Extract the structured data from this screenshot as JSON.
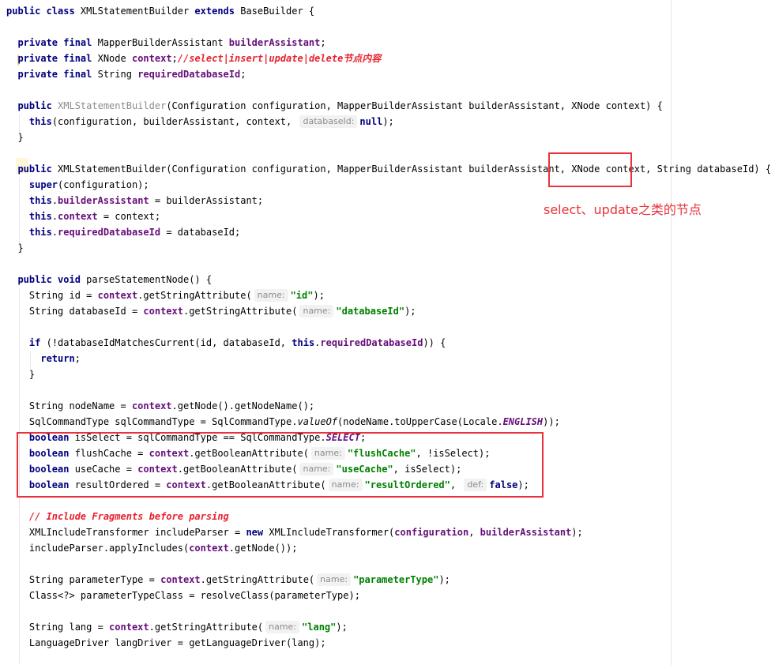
{
  "editor": {
    "language": "java",
    "colors": {
      "keyword": "#000080",
      "field": "#660e7a",
      "string": "#008000",
      "comment": "#e8222e",
      "highlight_box": "#e8333a",
      "hint_bg": "#f2f2f2"
    },
    "lines": [
      {
        "segs": [
          {
            "t": "public class ",
            "c": "kw"
          },
          {
            "t": "XMLStatementBuilder "
          },
          {
            "t": "extends ",
            "c": "kw"
          },
          {
            "t": "BaseBuilder {"
          }
        ]
      },
      {
        "segs": []
      },
      {
        "segs": [
          {
            "t": "  "
          },
          {
            "t": "private final ",
            "c": "kw"
          },
          {
            "t": "MapperBuilderAssistant "
          },
          {
            "t": "builderAssistant",
            "c": "field"
          },
          {
            "t": ";"
          }
        ]
      },
      {
        "segs": [
          {
            "t": "  "
          },
          {
            "t": "private final ",
            "c": "kw"
          },
          {
            "t": "XNode "
          },
          {
            "t": "context",
            "c": "field"
          },
          {
            "t": ";"
          },
          {
            "t": "//select|insert|update|delete节点内容",
            "c": "cmt"
          }
        ]
      },
      {
        "segs": [
          {
            "t": "  "
          },
          {
            "t": "private final ",
            "c": "kw"
          },
          {
            "t": "String "
          },
          {
            "t": "requiredDatabaseId",
            "c": "field"
          },
          {
            "t": ";"
          }
        ]
      },
      {
        "segs": []
      },
      {
        "segs": [
          {
            "t": "  "
          },
          {
            "t": "public ",
            "c": "kw"
          },
          {
            "t": "XMLStatementBuilder",
            "c": "unused"
          },
          {
            "t": "(Configuration configuration, MapperBuilderAssistant builderAssistant, XNode context) {"
          }
        ]
      },
      {
        "segs": [
          {
            "t": "    "
          },
          {
            "t": "this",
            "c": "kw"
          },
          {
            "t": "(configuration, builderAssistant, context, "
          },
          {
            "t": "databaseId:",
            "c": "hint"
          },
          {
            "t": "null",
            "c": "kw"
          },
          {
            "t": ");"
          }
        ]
      },
      {
        "segs": [
          {
            "t": "  }"
          }
        ]
      },
      {
        "segs": []
      },
      {
        "segs": [
          {
            "t": "  "
          },
          {
            "t": "public ",
            "c": "kw"
          },
          {
            "t": "XMLStatementBuilder(Configuration configuration, MapperBuilderAssistant builderAssistant, XNode context, String databaseId) {"
          }
        ]
      },
      {
        "segs": [
          {
            "t": "    "
          },
          {
            "t": "super",
            "c": "kw"
          },
          {
            "t": "(configuration);"
          }
        ]
      },
      {
        "segs": [
          {
            "t": "    "
          },
          {
            "t": "this",
            "c": "kw"
          },
          {
            "t": "."
          },
          {
            "t": "builderAssistant",
            "c": "field"
          },
          {
            "t": " = builderAssistant;"
          }
        ]
      },
      {
        "segs": [
          {
            "t": "    "
          },
          {
            "t": "this",
            "c": "kw"
          },
          {
            "t": "."
          },
          {
            "t": "context",
            "c": "field"
          },
          {
            "t": " = context;"
          }
        ]
      },
      {
        "segs": [
          {
            "t": "    "
          },
          {
            "t": "this",
            "c": "kw"
          },
          {
            "t": "."
          },
          {
            "t": "requiredDatabaseId",
            "c": "field"
          },
          {
            "t": " = databaseId;"
          }
        ]
      },
      {
        "segs": [
          {
            "t": "  }"
          }
        ]
      },
      {
        "segs": []
      },
      {
        "segs": [
          {
            "t": "  "
          },
          {
            "t": "public void ",
            "c": "kw"
          },
          {
            "t": "parseStatementNode() {"
          }
        ]
      },
      {
        "segs": [
          {
            "t": "    String id = "
          },
          {
            "t": "context",
            "c": "field"
          },
          {
            "t": ".getStringAttribute("
          },
          {
            "t": "name:",
            "c": "hint"
          },
          {
            "t": "\"id\"",
            "c": "str"
          },
          {
            "t": ");"
          }
        ]
      },
      {
        "segs": [
          {
            "t": "    String databaseId = "
          },
          {
            "t": "context",
            "c": "field"
          },
          {
            "t": ".getStringAttribute("
          },
          {
            "t": "name:",
            "c": "hint"
          },
          {
            "t": "\"databaseId\"",
            "c": "str"
          },
          {
            "t": ");"
          }
        ]
      },
      {
        "segs": []
      },
      {
        "segs": [
          {
            "t": "    "
          },
          {
            "t": "if ",
            "c": "kw"
          },
          {
            "t": "(!databaseIdMatchesCurrent(id, databaseId, "
          },
          {
            "t": "this",
            "c": "kw"
          },
          {
            "t": "."
          },
          {
            "t": "requiredDatabaseId",
            "c": "field"
          },
          {
            "t": ")) {"
          }
        ]
      },
      {
        "segs": [
          {
            "t": "      "
          },
          {
            "t": "return",
            "c": "kw"
          },
          {
            "t": ";"
          }
        ]
      },
      {
        "segs": [
          {
            "t": "    }"
          }
        ]
      },
      {
        "segs": []
      },
      {
        "segs": [
          {
            "t": "    String nodeName = "
          },
          {
            "t": "context",
            "c": "field"
          },
          {
            "t": ".getNode().getNodeName();"
          }
        ]
      },
      {
        "segs": [
          {
            "t": "    SqlCommandType sqlCommandType = SqlCommandType."
          },
          {
            "t": "valueOf",
            "c": "italic-m"
          },
          {
            "t": "(nodeName.toUpperCase(Locale."
          },
          {
            "t": "ENGLISH",
            "c": "static"
          },
          {
            "t": "));"
          }
        ]
      },
      {
        "segs": [
          {
            "t": "    "
          },
          {
            "t": "boolean ",
            "c": "kw"
          },
          {
            "t": "isSelect = sqlCommandType == SqlCommandType."
          },
          {
            "t": "SELECT",
            "c": "static"
          },
          {
            "t": ";"
          }
        ]
      },
      {
        "segs": [
          {
            "t": "    "
          },
          {
            "t": "boolean ",
            "c": "kw"
          },
          {
            "t": "flushCache = "
          },
          {
            "t": "context",
            "c": "field"
          },
          {
            "t": ".getBooleanAttribute("
          },
          {
            "t": "name:",
            "c": "hint"
          },
          {
            "t": "\"flushCache\"",
            "c": "str"
          },
          {
            "t": ", !isSelect);"
          }
        ]
      },
      {
        "segs": [
          {
            "t": "    "
          },
          {
            "t": "boolean ",
            "c": "kw"
          },
          {
            "t": "useCache = "
          },
          {
            "t": "context",
            "c": "field"
          },
          {
            "t": ".getBooleanAttribute("
          },
          {
            "t": "name:",
            "c": "hint"
          },
          {
            "t": "\"useCache\"",
            "c": "str"
          },
          {
            "t": ", isSelect);"
          }
        ]
      },
      {
        "segs": [
          {
            "t": "    "
          },
          {
            "t": "boolean ",
            "c": "kw"
          },
          {
            "t": "resultOrdered = "
          },
          {
            "t": "context",
            "c": "field"
          },
          {
            "t": ".getBooleanAttribute("
          },
          {
            "t": "name:",
            "c": "hint"
          },
          {
            "t": "\"resultOrdered\"",
            "c": "str"
          },
          {
            "t": ", "
          },
          {
            "t": "def:",
            "c": "hint"
          },
          {
            "t": "false",
            "c": "kw"
          },
          {
            "t": ");"
          }
        ]
      },
      {
        "segs": []
      },
      {
        "segs": [
          {
            "t": "    "
          },
          {
            "t": "// Include Fragments before parsing",
            "c": "cmt"
          }
        ]
      },
      {
        "segs": [
          {
            "t": "    XMLIncludeTransformer includeParser = "
          },
          {
            "t": "new ",
            "c": "kw"
          },
          {
            "t": "XMLIncludeTransformer("
          },
          {
            "t": "configuration",
            "c": "field"
          },
          {
            "t": ", "
          },
          {
            "t": "builderAssistant",
            "c": "field"
          },
          {
            "t": ");"
          }
        ]
      },
      {
        "segs": [
          {
            "t": "    includeParser.applyIncludes("
          },
          {
            "t": "context",
            "c": "field"
          },
          {
            "t": ".getNode());"
          }
        ]
      },
      {
        "segs": []
      },
      {
        "segs": [
          {
            "t": "    String parameterType = "
          },
          {
            "t": "context",
            "c": "field"
          },
          {
            "t": ".getStringAttribute("
          },
          {
            "t": "name:",
            "c": "hint"
          },
          {
            "t": "\"parameterType\"",
            "c": "str"
          },
          {
            "t": ");"
          }
        ]
      },
      {
        "segs": [
          {
            "t": "    Class<?> parameterTypeClass = resolveClass(parameterType);"
          }
        ]
      },
      {
        "segs": []
      },
      {
        "segs": [
          {
            "t": "    String lang = "
          },
          {
            "t": "context",
            "c": "field"
          },
          {
            "t": ".getStringAttribute("
          },
          {
            "t": "name:",
            "c": "hint"
          },
          {
            "t": "\"lang\"",
            "c": "str"
          },
          {
            "t": ");"
          }
        ]
      },
      {
        "segs": [
          {
            "t": "    LanguageDriver langDriver = getLanguageDriver(lang);"
          }
        ]
      }
    ]
  },
  "annotation": {
    "text": "select、update之类的节点"
  }
}
